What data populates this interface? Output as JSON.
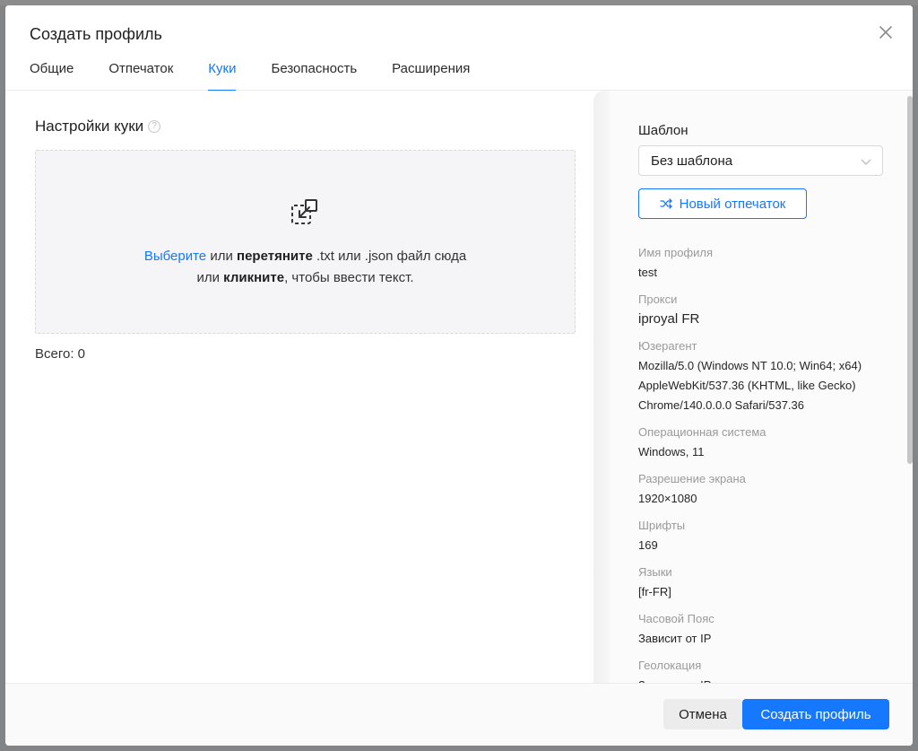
{
  "modal": {
    "title": "Создать профиль",
    "tabs": [
      {
        "label": "Общие",
        "active": false
      },
      {
        "label": "Отпечаток",
        "active": false
      },
      {
        "label": "Куки",
        "active": true
      },
      {
        "label": "Безопасность",
        "active": false
      },
      {
        "label": "Расширения",
        "active": false
      }
    ]
  },
  "cookies": {
    "section_title": "Настройки куки",
    "help_glyph": "?",
    "drop_choose": "Выберите",
    "drop_or": " или ",
    "drop_drag": "перетяните",
    "drop_files": " .txt или .json файл сюда",
    "drop_or2": "или ",
    "drop_click": "кликните",
    "drop_rest": ", чтобы ввести текст.",
    "total": "Всего: 0"
  },
  "sidebar": {
    "template_label": "Шаблон",
    "template_value": "Без шаблона",
    "new_fingerprint_button": "Новый отпечаток",
    "info": [
      {
        "label": "Имя профиля",
        "value": "test",
        "large": false
      },
      {
        "label": "Прокси",
        "value": "iproyal FR",
        "large": true
      },
      {
        "label": "Юзерагент",
        "value": "Mozilla/5.0 (Windows NT 10.0; Win64; x64) AppleWebKit/537.36 (KHTML, like Gecko) Chrome/140.0.0.0 Safari/537.36",
        "large": false
      },
      {
        "label": "Операционная система",
        "value": "Windows, 11",
        "large": false
      },
      {
        "label": "Разрешение экрана",
        "value": "1920×1080",
        "large": false
      },
      {
        "label": "Шрифты",
        "value": "169",
        "large": false
      },
      {
        "label": "Языки",
        "value": "[fr-FR]",
        "large": false
      },
      {
        "label": "Часовой Пояс",
        "value": "Зависит от IP",
        "large": false
      },
      {
        "label": "Геолокация",
        "value": "Зависит от IP",
        "large": false
      }
    ]
  },
  "footer": {
    "cancel_label": "Отмена",
    "create_label": "Создать профиль"
  },
  "colors": {
    "accent": "#1677ff",
    "muted_label": "#9a9a9a"
  }
}
